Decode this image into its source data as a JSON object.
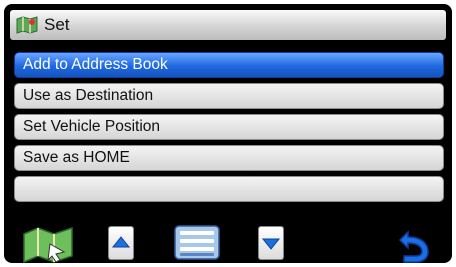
{
  "title": {
    "label": "Set",
    "icon": "map-icon"
  },
  "menu": {
    "items": [
      {
        "label": "Add to Address Book",
        "selected": true
      },
      {
        "label": "Use as Destination",
        "selected": false
      },
      {
        "label": "Set Vehicle Position",
        "selected": false
      },
      {
        "label": "Save as HOME",
        "selected": false
      },
      {
        "label": "",
        "selected": false
      }
    ]
  },
  "toolbar": {
    "buttons": [
      {
        "name": "map-view-icon"
      },
      {
        "name": "scroll-up-icon"
      },
      {
        "name": "list-icon"
      },
      {
        "name": "scroll-down-icon"
      },
      {
        "name": "back-icon"
      }
    ]
  },
  "colors": {
    "selected": "#1e68e0",
    "background": "#000000",
    "titlebar": "#d4d4d4"
  }
}
